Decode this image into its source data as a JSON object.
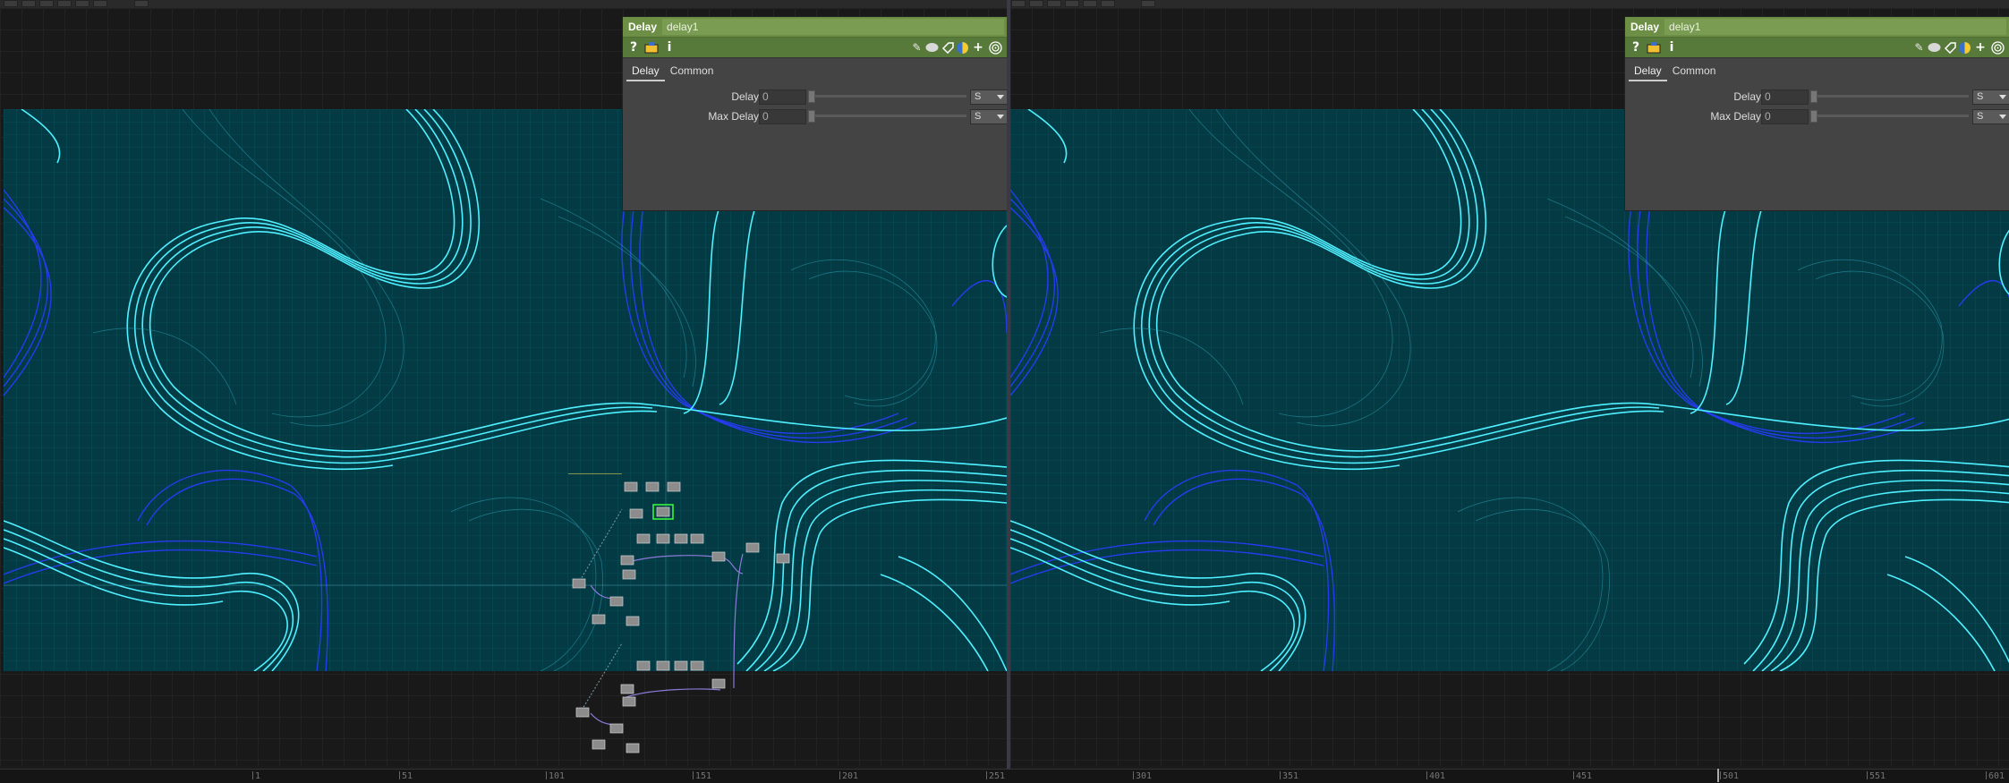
{
  "left_pane": {
    "panel": {
      "op_type": "Delay",
      "op_name": "delay1",
      "tabs": [
        "Delay",
        "Common"
      ],
      "params": [
        {
          "label": "Delay",
          "value": "0",
          "unit": "S"
        },
        {
          "label": "Max Delay",
          "value": "0",
          "unit": "S"
        }
      ]
    }
  },
  "right_pane": {
    "panel": {
      "op_type": "Delay",
      "op_name": "delay1",
      "tabs": [
        "Delay",
        "Common"
      ],
      "params": [
        {
          "label": "Delay",
          "value": "0",
          "unit": "S"
        },
        {
          "label": "Max Delay",
          "value": "0",
          "unit": "S"
        }
      ]
    }
  },
  "panel_tools": {
    "help_icon": "?",
    "info_icon": "i",
    "add_icon": "+"
  },
  "timeline": {
    "ticks": [
      "1",
      "51",
      "101",
      "151",
      "201",
      "251",
      "301",
      "351",
      "401",
      "451",
      "501",
      "551",
      "601"
    ]
  },
  "colors": {
    "panel_title": "#6d8f45",
    "viewer_bg": "#033a44",
    "line_cyan": "#3fe6f0",
    "line_blue": "#2233ff"
  }
}
